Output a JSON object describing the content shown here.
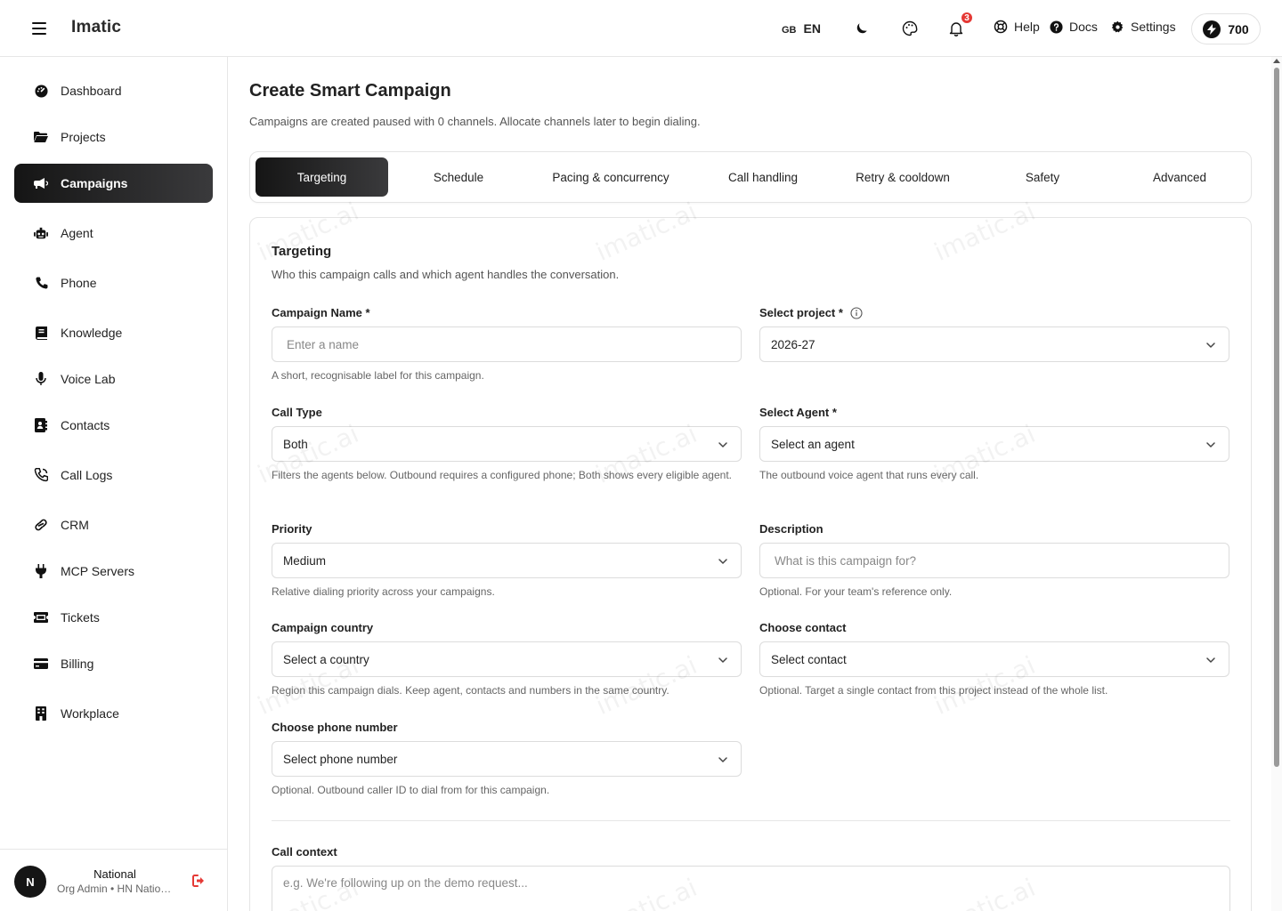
{
  "header": {
    "app_name": "Imatic",
    "lang_flag": "GB",
    "lang_code": "EN",
    "notifications_count": "3",
    "help_label": "Help",
    "docs_label": "Docs",
    "settings_label": "Settings",
    "credits": "700"
  },
  "sidebar": {
    "items": [
      {
        "label": "Dashboard",
        "icon": "gauge-icon"
      },
      {
        "label": "Projects",
        "icon": "folder-icon"
      },
      {
        "label": "Campaigns",
        "icon": "megaphone-icon",
        "active": true
      },
      {
        "label": "Agent",
        "icon": "robot-icon"
      },
      {
        "label": "Phone",
        "icon": "phone-icon"
      },
      {
        "label": "Knowledge",
        "icon": "book-icon"
      },
      {
        "label": "Voice Lab",
        "icon": "microphone-icon"
      },
      {
        "label": "Contacts",
        "icon": "address-book-icon"
      },
      {
        "label": "Call Logs",
        "icon": "phone-log-icon"
      },
      {
        "label": "CRM",
        "icon": "link-icon"
      },
      {
        "label": "MCP Servers",
        "icon": "plug-icon"
      },
      {
        "label": "Tickets",
        "icon": "ticket-icon"
      },
      {
        "label": "Billing",
        "icon": "credit-card-icon"
      },
      {
        "label": "Workplace",
        "icon": "building-icon"
      }
    ],
    "footer": {
      "avatar_initial": "N",
      "org_name": "National",
      "org_role": "Org Admin • HN National"
    }
  },
  "main": {
    "title": "Create Smart Campaign",
    "subtitle": "Campaigns are created paused with 0 channels. Allocate channels later to begin dialing.",
    "tabs": [
      {
        "label": "Targeting",
        "active": true
      },
      {
        "label": "Schedule"
      },
      {
        "label": "Pacing & concurrency"
      },
      {
        "label": "Call handling"
      },
      {
        "label": "Retry & cooldown"
      },
      {
        "label": "Safety"
      },
      {
        "label": "Advanced"
      }
    ],
    "section": {
      "title": "Targeting",
      "subtitle": "Who this campaign calls and which agent handles the conversation."
    },
    "fields": {
      "campaign_name": {
        "label": "Campaign Name *",
        "placeholder": "Enter a name",
        "hint": "A short, recognisable label for this campaign."
      },
      "project": {
        "label": "Select project *",
        "value": "2026-27"
      },
      "call_type": {
        "label": "Call Type",
        "value": "Both",
        "hint": "Filters the agents below. Outbound requires a configured phone; Both shows every eligible agent."
      },
      "agent": {
        "label": "Select Agent *",
        "value": "Select an agent",
        "hint": "The outbound voice agent that runs every call."
      },
      "priority": {
        "label": "Priority",
        "value": "Medium",
        "hint": "Relative dialing priority across your campaigns."
      },
      "description": {
        "label": "Description",
        "placeholder": "What is this campaign for?",
        "hint": "Optional. For your team's reference only."
      },
      "country": {
        "label": "Campaign country",
        "value": "Select a country",
        "hint": "Region this campaign dials. Keep agent, contacts and numbers in the same country."
      },
      "contact": {
        "label": "Choose contact",
        "value": "Select contact",
        "hint": "Optional. Target a single contact from this project instead of the whole list."
      },
      "phone_number": {
        "label": "Choose phone number",
        "value": "Select phone number",
        "hint": "Optional. Outbound caller ID to dial from for this campaign."
      },
      "call_context": {
        "label": "Call context",
        "placeholder": "e.g. We're following up on the demo request..."
      }
    }
  },
  "watermark": "imatic.ai",
  "colors": {
    "accent_dark": "#151515",
    "badge_red": "#e53935",
    "logout_red": "#e53935"
  }
}
